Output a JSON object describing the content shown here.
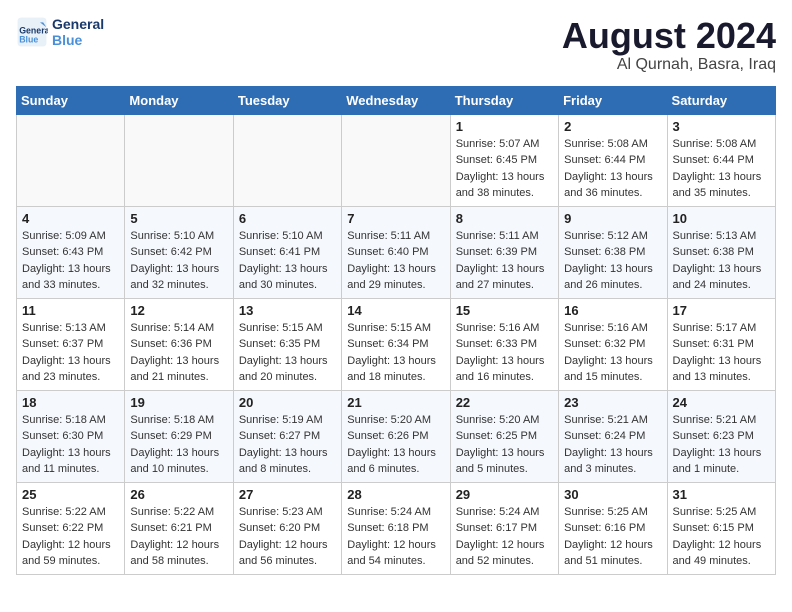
{
  "logo": {
    "line1": "General",
    "line2": "Blue"
  },
  "title": "August 2024",
  "subtitle": "Al Qurnah, Basra, Iraq",
  "headers": [
    "Sunday",
    "Monday",
    "Tuesday",
    "Wednesday",
    "Thursday",
    "Friday",
    "Saturday"
  ],
  "weeks": [
    [
      {
        "day": "",
        "info": ""
      },
      {
        "day": "",
        "info": ""
      },
      {
        "day": "",
        "info": ""
      },
      {
        "day": "",
        "info": ""
      },
      {
        "day": "1",
        "info": "Sunrise: 5:07 AM\nSunset: 6:45 PM\nDaylight: 13 hours\nand 38 minutes."
      },
      {
        "day": "2",
        "info": "Sunrise: 5:08 AM\nSunset: 6:44 PM\nDaylight: 13 hours\nand 36 minutes."
      },
      {
        "day": "3",
        "info": "Sunrise: 5:08 AM\nSunset: 6:44 PM\nDaylight: 13 hours\nand 35 minutes."
      }
    ],
    [
      {
        "day": "4",
        "info": "Sunrise: 5:09 AM\nSunset: 6:43 PM\nDaylight: 13 hours\nand 33 minutes."
      },
      {
        "day": "5",
        "info": "Sunrise: 5:10 AM\nSunset: 6:42 PM\nDaylight: 13 hours\nand 32 minutes."
      },
      {
        "day": "6",
        "info": "Sunrise: 5:10 AM\nSunset: 6:41 PM\nDaylight: 13 hours\nand 30 minutes."
      },
      {
        "day": "7",
        "info": "Sunrise: 5:11 AM\nSunset: 6:40 PM\nDaylight: 13 hours\nand 29 minutes."
      },
      {
        "day": "8",
        "info": "Sunrise: 5:11 AM\nSunset: 6:39 PM\nDaylight: 13 hours\nand 27 minutes."
      },
      {
        "day": "9",
        "info": "Sunrise: 5:12 AM\nSunset: 6:38 PM\nDaylight: 13 hours\nand 26 minutes."
      },
      {
        "day": "10",
        "info": "Sunrise: 5:13 AM\nSunset: 6:38 PM\nDaylight: 13 hours\nand 24 minutes."
      }
    ],
    [
      {
        "day": "11",
        "info": "Sunrise: 5:13 AM\nSunset: 6:37 PM\nDaylight: 13 hours\nand 23 minutes."
      },
      {
        "day": "12",
        "info": "Sunrise: 5:14 AM\nSunset: 6:36 PM\nDaylight: 13 hours\nand 21 minutes."
      },
      {
        "day": "13",
        "info": "Sunrise: 5:15 AM\nSunset: 6:35 PM\nDaylight: 13 hours\nand 20 minutes."
      },
      {
        "day": "14",
        "info": "Sunrise: 5:15 AM\nSunset: 6:34 PM\nDaylight: 13 hours\nand 18 minutes."
      },
      {
        "day": "15",
        "info": "Sunrise: 5:16 AM\nSunset: 6:33 PM\nDaylight: 13 hours\nand 16 minutes."
      },
      {
        "day": "16",
        "info": "Sunrise: 5:16 AM\nSunset: 6:32 PM\nDaylight: 13 hours\nand 15 minutes."
      },
      {
        "day": "17",
        "info": "Sunrise: 5:17 AM\nSunset: 6:31 PM\nDaylight: 13 hours\nand 13 minutes."
      }
    ],
    [
      {
        "day": "18",
        "info": "Sunrise: 5:18 AM\nSunset: 6:30 PM\nDaylight: 13 hours\nand 11 minutes."
      },
      {
        "day": "19",
        "info": "Sunrise: 5:18 AM\nSunset: 6:29 PM\nDaylight: 13 hours\nand 10 minutes."
      },
      {
        "day": "20",
        "info": "Sunrise: 5:19 AM\nSunset: 6:27 PM\nDaylight: 13 hours\nand 8 minutes."
      },
      {
        "day": "21",
        "info": "Sunrise: 5:20 AM\nSunset: 6:26 PM\nDaylight: 13 hours\nand 6 minutes."
      },
      {
        "day": "22",
        "info": "Sunrise: 5:20 AM\nSunset: 6:25 PM\nDaylight: 13 hours\nand 5 minutes."
      },
      {
        "day": "23",
        "info": "Sunrise: 5:21 AM\nSunset: 6:24 PM\nDaylight: 13 hours\nand 3 minutes."
      },
      {
        "day": "24",
        "info": "Sunrise: 5:21 AM\nSunset: 6:23 PM\nDaylight: 13 hours\nand 1 minute."
      }
    ],
    [
      {
        "day": "25",
        "info": "Sunrise: 5:22 AM\nSunset: 6:22 PM\nDaylight: 12 hours\nand 59 minutes."
      },
      {
        "day": "26",
        "info": "Sunrise: 5:22 AM\nSunset: 6:21 PM\nDaylight: 12 hours\nand 58 minutes."
      },
      {
        "day": "27",
        "info": "Sunrise: 5:23 AM\nSunset: 6:20 PM\nDaylight: 12 hours\nand 56 minutes."
      },
      {
        "day": "28",
        "info": "Sunrise: 5:24 AM\nSunset: 6:18 PM\nDaylight: 12 hours\nand 54 minutes."
      },
      {
        "day": "29",
        "info": "Sunrise: 5:24 AM\nSunset: 6:17 PM\nDaylight: 12 hours\nand 52 minutes."
      },
      {
        "day": "30",
        "info": "Sunrise: 5:25 AM\nSunset: 6:16 PM\nDaylight: 12 hours\nand 51 minutes."
      },
      {
        "day": "31",
        "info": "Sunrise: 5:25 AM\nSunset: 6:15 PM\nDaylight: 12 hours\nand 49 minutes."
      }
    ]
  ]
}
